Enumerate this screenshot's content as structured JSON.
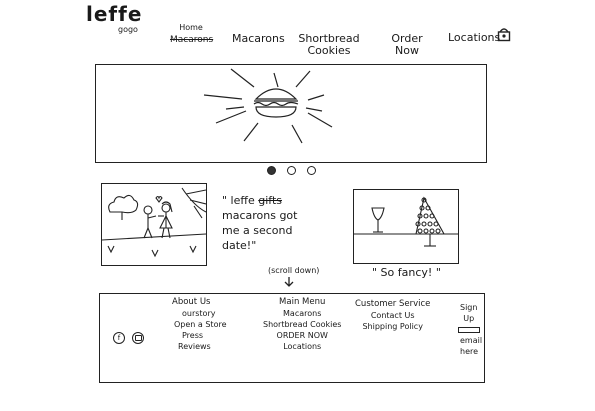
{
  "logo": {
    "wordmark": "leffe",
    "subtext": "gogo"
  },
  "nav": {
    "home_top": "Home",
    "home_struck": "Macarons",
    "macarons": "Macarons",
    "shortbread": "Shortbread\nCookies",
    "order": "Order\nNow",
    "locations": "Locations"
  },
  "icons": {
    "cart": "bag-icon",
    "facebook": "facebook-icon",
    "instagram": "instagram-icon"
  },
  "testimonial": {
    "quote_prefix": "\" leffe",
    "quote_struck": "gifts",
    "quote_rest": "macarons got\nme a second\ndate!\"",
    "scroll_hint": "(scroll down)",
    "caption": "\" So fancy! \""
  },
  "footer": {
    "about": {
      "heading": "About Us",
      "items": [
        "ourstory",
        "Open a Store",
        "Press",
        "Reviews"
      ]
    },
    "menu": {
      "heading": "Main Menu",
      "items": [
        "Macarons",
        "Shortbread Cookies",
        "ORDER NOW",
        "Locations"
      ]
    },
    "service": {
      "heading": "Customer Service",
      "items": [
        "Contact Us",
        "Shipping Policy"
      ]
    },
    "signup": {
      "heading": "Sign\nUp",
      "email_label": "email\nhere"
    }
  }
}
